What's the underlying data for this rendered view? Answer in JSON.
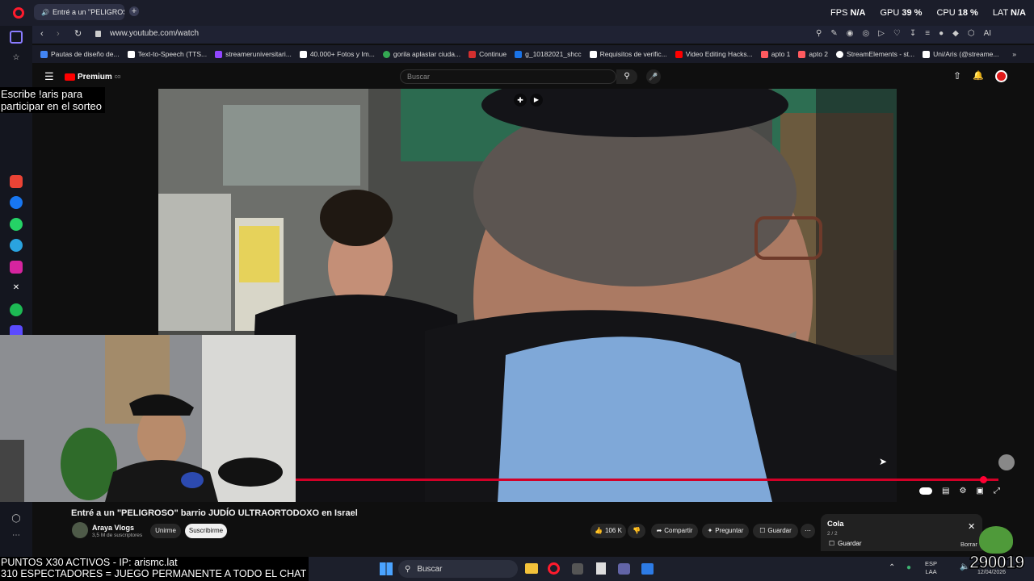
{
  "browser": {
    "tab_title": "Entré a un \"PELIGROSO",
    "url": "www.youtube.com/watch",
    "stats": [
      {
        "label": "FPS",
        "value": "N/A"
      },
      {
        "label": "GPU",
        "value": "39 %"
      },
      {
        "label": "CPU",
        "value": "18 %"
      },
      {
        "label": "LAT",
        "value": "N/A"
      }
    ],
    "bookmarks": [
      {
        "label": "Pautas de diseño de...",
        "color": "#4285f4"
      },
      {
        "label": "Text-to-Speech (TTS...",
        "color": "#ffffff"
      },
      {
        "label": "streameruniversitari...",
        "color": "#9146ff"
      },
      {
        "label": "40.000+ Fotos y Im...",
        "color": "#ffffff"
      },
      {
        "label": "gorila aplastar ciuda...",
        "color": "#34a853"
      },
      {
        "label": "Continue",
        "color": "#d32f2f"
      },
      {
        "label": "g_10182021_shcc",
        "color": "#1a73e8"
      },
      {
        "label": "Requisitos de verific...",
        "color": "#ffffff"
      },
      {
        "label": "Video Editing Hacks...",
        "color": "#ff0000"
      },
      {
        "label": "apto 1",
        "color": "#ff5a5f"
      },
      {
        "label": "apto 2",
        "color": "#ff5a5f"
      },
      {
        "label": "StreamElements - st...",
        "color": "#ffffff"
      },
      {
        "label": "Uni/Aris (@streame...",
        "color": "#ffffff"
      }
    ]
  },
  "youtube": {
    "logo": "Premium",
    "logo_sup": "CO",
    "search_placeholder": "Buscar",
    "video_title": "Entré a un \"PELIGROSO\" barrio JUDÍO ULTRAORTODOXO en Israel",
    "channel_name": "Araya Vlogs",
    "subscribers": "3,5 M de suscriptores",
    "join_label": "Unirme",
    "subscribe_label": "Suscribirme",
    "likes": "106 K",
    "share_label": "Compartir",
    "ask_label": "Preguntar",
    "save_label": "Guardar",
    "queue_title": "Cola",
    "queue_count": "2 / 2",
    "queue_save": "Guardar",
    "queue_clear": "Borrar",
    "progress": 0.985
  },
  "stream_overlay": {
    "top_text": "Escribe !aris para participar en el sorteo",
    "bottom_line1": "PUNTOS X30 ACTIVOS - IP: arismc.lat",
    "bottom_line2": "310 ESPECTADORES = JUEGO PERMANENTE A TODO EL CHAT",
    "counter": "290019"
  },
  "taskbar": {
    "search_placeholder": "Buscar",
    "lang1": "ESP",
    "lang2": "LAA",
    "date": "12/04/2026"
  }
}
